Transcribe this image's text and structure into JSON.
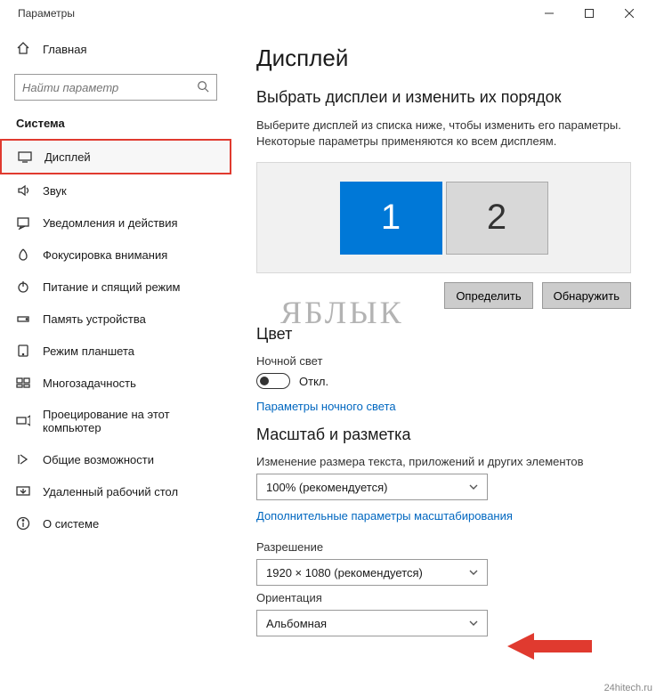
{
  "window": {
    "title": "Параметры"
  },
  "sidebar": {
    "home_label": "Главная",
    "search_placeholder": "Найти параметр",
    "section_title": "Система",
    "items": [
      {
        "label": "Дисплей",
        "icon": "display-icon",
        "selected": true
      },
      {
        "label": "Звук",
        "icon": "sound-icon"
      },
      {
        "label": "Уведомления и действия",
        "icon": "notifications-icon"
      },
      {
        "label": "Фокусировка внимания",
        "icon": "focus-icon"
      },
      {
        "label": "Питание и спящий режим",
        "icon": "power-icon"
      },
      {
        "label": "Память устройства",
        "icon": "storage-icon"
      },
      {
        "label": "Режим планшета",
        "icon": "tablet-icon"
      },
      {
        "label": "Многозадачность",
        "icon": "multitask-icon"
      },
      {
        "label": "Проецирование на этот компьютер",
        "icon": "project-icon"
      },
      {
        "label": "Общие возможности",
        "icon": "shared-icon"
      },
      {
        "label": "Удаленный рабочий стол",
        "icon": "remote-icon"
      },
      {
        "label": "О системе",
        "icon": "info-icon"
      }
    ]
  },
  "main": {
    "heading": "Дисплей",
    "arrange_heading": "Выбрать дисплеи и изменить их порядок",
    "arrange_description": "Выберите дисплей из списка ниже, чтобы изменить его параметры. Некоторые параметры применяются ко всем дисплеям.",
    "monitors": [
      {
        "id": "1",
        "primary": true
      },
      {
        "id": "2",
        "primary": false
      }
    ],
    "identify_btn": "Определить",
    "detect_btn": "Обнаружить",
    "color_heading": "Цвет",
    "night_light_label": "Ночной свет",
    "night_light_state": "Откл.",
    "night_light_link": "Параметры ночного света",
    "scale_heading": "Масштаб и разметка",
    "scale_label": "Изменение размера текста, приложений и других элементов",
    "scale_value": "100% (рекомендуется)",
    "advanced_scale_link": "Дополнительные параметры масштабирования",
    "resolution_label": "Разрешение",
    "resolution_value": "1920 × 1080 (рекомендуется)",
    "orientation_label": "Ориентация",
    "orientation_value": "Альбомная"
  },
  "watermark": "ЯБЛЫК",
  "credit": "24hitech.ru"
}
